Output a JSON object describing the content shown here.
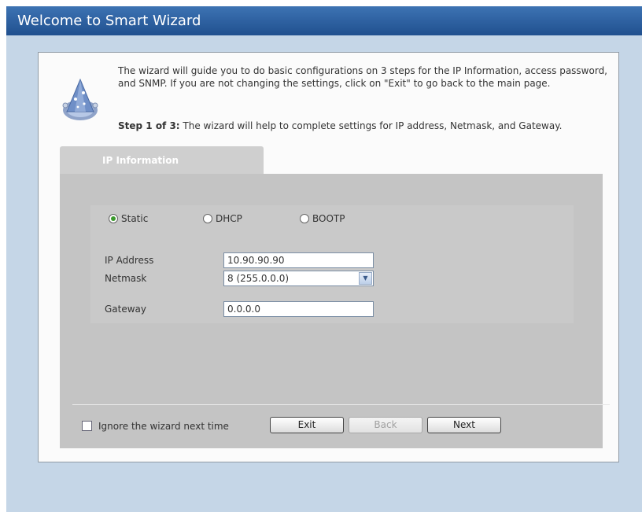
{
  "window": {
    "title": "Welcome to Smart Wizard"
  },
  "intro": {
    "text": "The wizard will guide you to do basic configurations on 3 steps for the IP Information, access password, and SNMP. If you are not changing the settings, click on \"Exit\" to go back to the main page.",
    "step_label": "Step 1 of 3:",
    "step_text": " The wizard will help to complete settings for IP address, Netmask, and Gateway.",
    "icon": "wizard-hat-icon"
  },
  "tab": {
    "label": "IP Information"
  },
  "mode": {
    "options": [
      {
        "label": "Static",
        "selected": true
      },
      {
        "label": "DHCP",
        "selected": false
      },
      {
        "label": "BOOTP",
        "selected": false
      }
    ]
  },
  "form": {
    "ip_label": "IP Address",
    "ip_value": "10.90.90.90",
    "netmask_label": "Netmask",
    "netmask_value": "8 (255.0.0.0)",
    "gateway_label": "Gateway",
    "gateway_value": "0.0.0.0"
  },
  "footer": {
    "ignore_label": "Ignore the wizard next time",
    "ignore_checked": false,
    "exit_label": "Exit",
    "back_label": "Back",
    "back_enabled": false,
    "next_label": "Next"
  },
  "colors": {
    "title_bar": "#2b5f9f",
    "background": "#c5d6e7",
    "panel": "#fbfbfb",
    "form_bg": "#c4c4c4",
    "selected_radio": "#3b9a2d"
  }
}
